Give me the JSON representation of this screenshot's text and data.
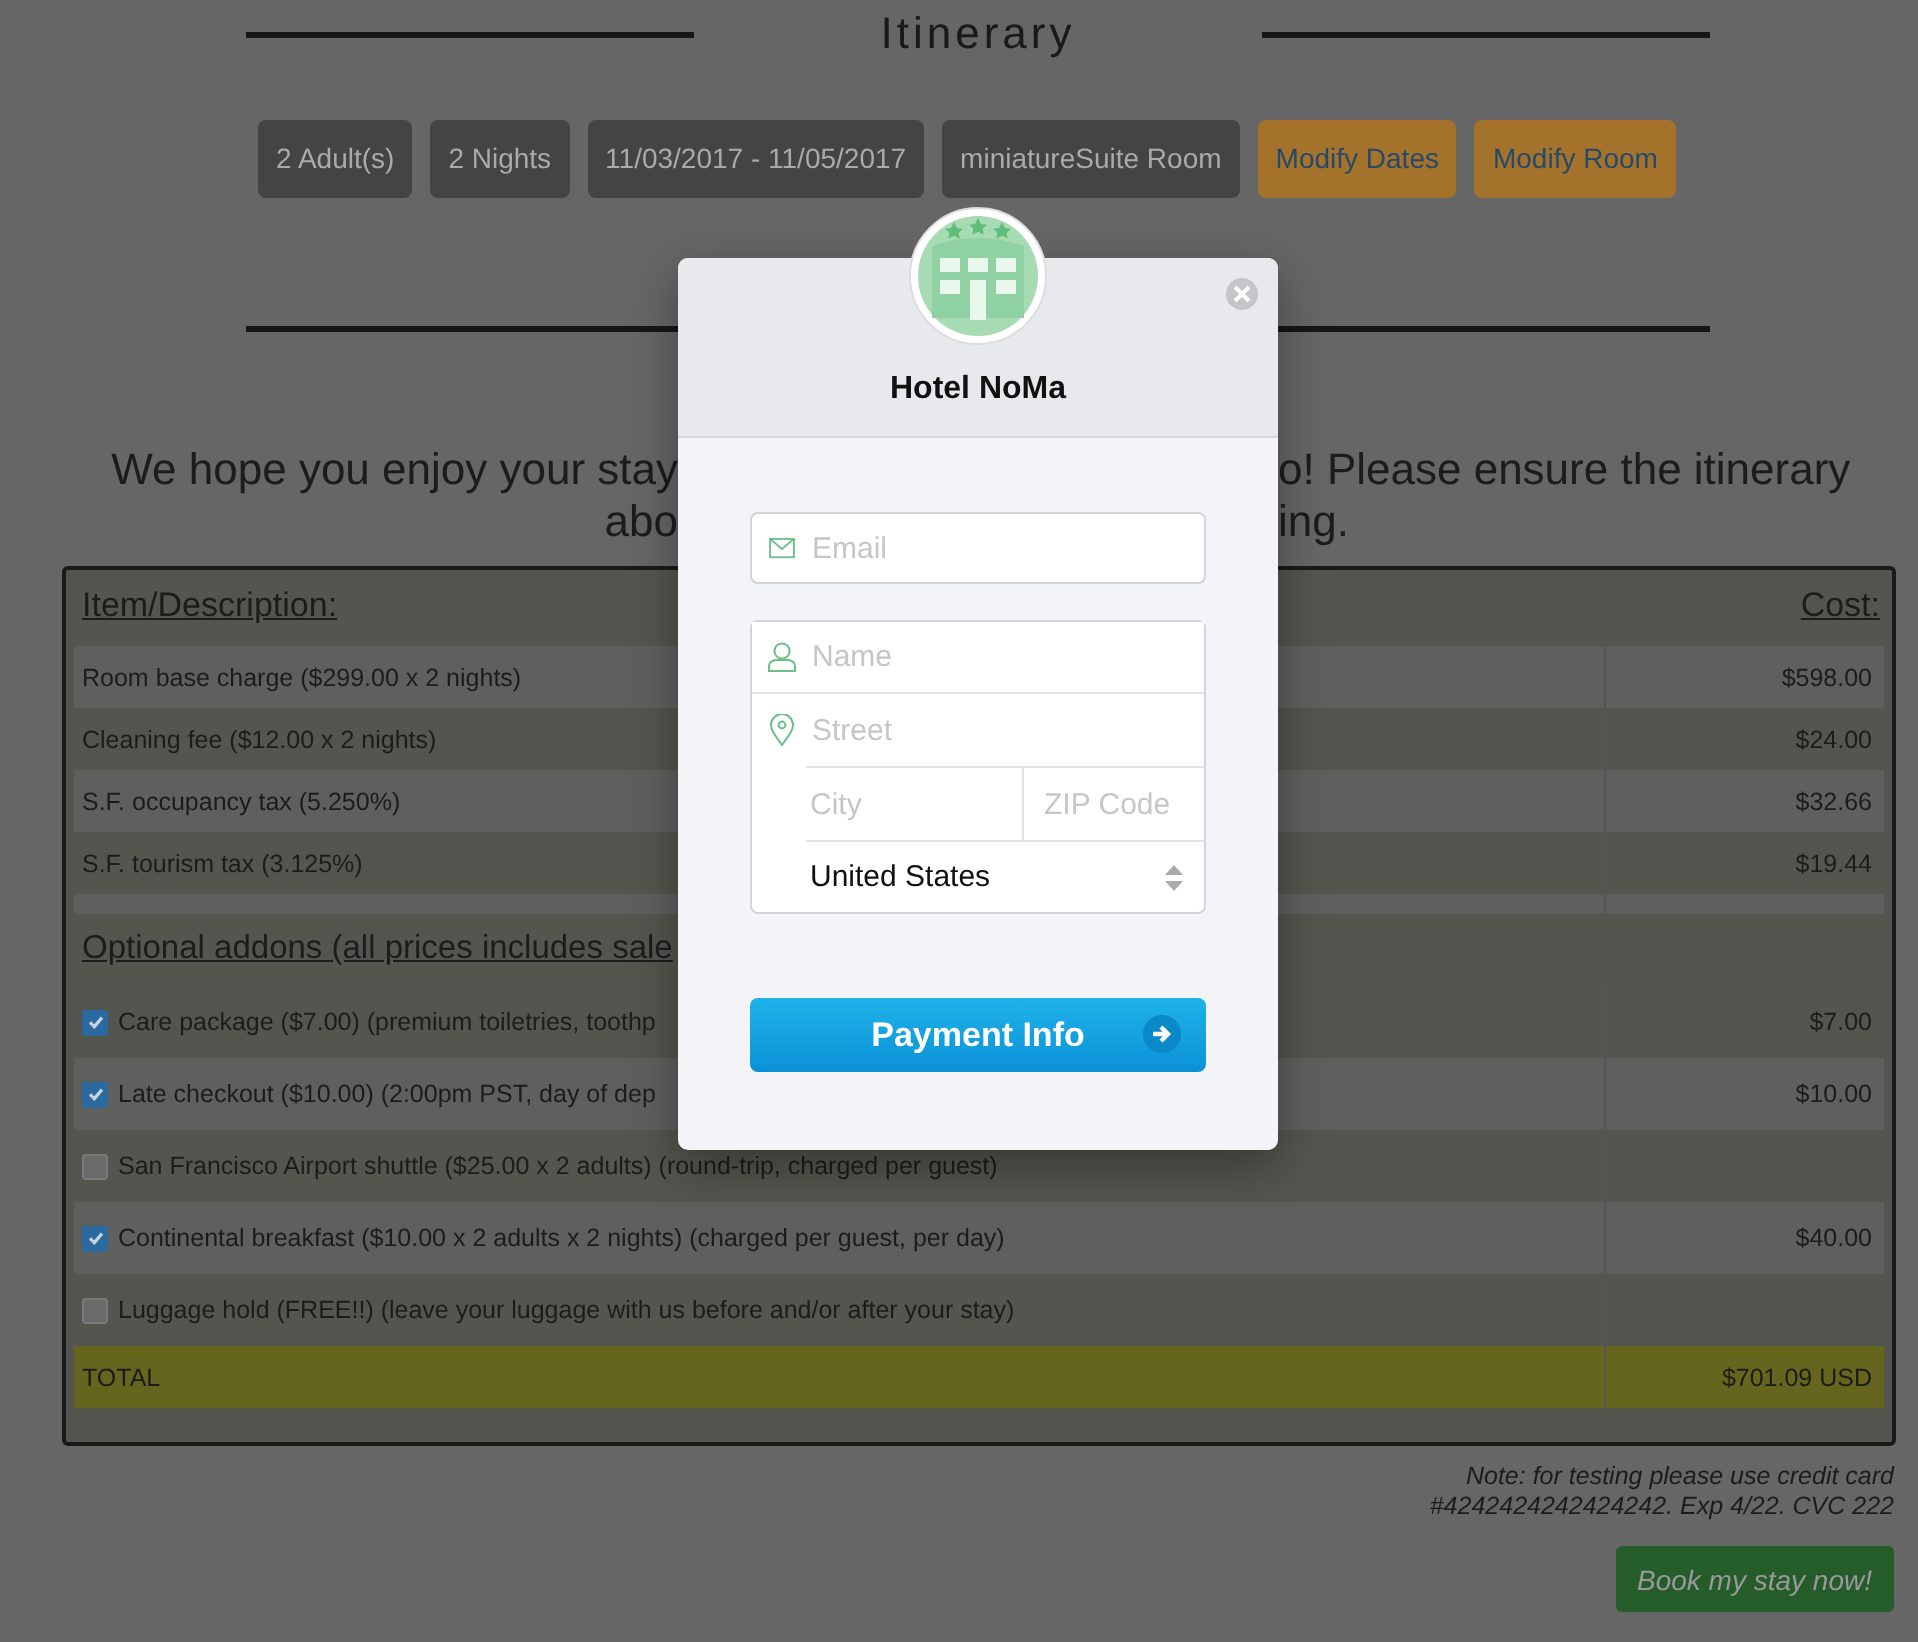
{
  "header": {
    "title": "Itinerary"
  },
  "chips": [
    {
      "label": "2 Adult(s)",
      "kind": "info"
    },
    {
      "label": "2 Nights",
      "kind": "info"
    },
    {
      "label": "11/03/2017 - 11/05/2017",
      "kind": "info"
    },
    {
      "label": "miniatureSuite Room",
      "kind": "info"
    },
    {
      "label": "Modify Dates",
      "kind": "action"
    },
    {
      "label": "Modify Room",
      "kind": "action"
    }
  ],
  "intro": [
    {
      "left": "We hope you enjoy your stay",
      "right": "o! Please ensure the itinerary"
    },
    {
      "left": "abo",
      "right": "ing."
    }
  ],
  "table": {
    "columns": [
      "Item/Description:",
      "Cost:"
    ],
    "rows": [
      {
        "kind": "item",
        "description": "Room base charge ($299.00 x 2 nights)",
        "cost": "$598.00"
      },
      {
        "kind": "item",
        "description": "Cleaning fee ($12.00 x 2 nights)",
        "cost": "$24.00"
      },
      {
        "kind": "item",
        "description": "S.F. occupancy tax (5.250%)",
        "cost": "$32.66"
      },
      {
        "kind": "item",
        "description": "S.F. tourism tax (3.125%)",
        "cost": "$19.44"
      },
      {
        "kind": "spacer"
      },
      {
        "kind": "heading",
        "description": "Optional addons (all prices includes sale"
      },
      {
        "kind": "addon",
        "checked": true,
        "description": "Care package ($7.00) (premium toiletries, toothp",
        "cost": "$7.00"
      },
      {
        "kind": "addon",
        "checked": true,
        "description": "Late checkout ($10.00) (2:00pm PST, day of dep",
        "cost": "$10.00"
      },
      {
        "kind": "addon",
        "checked": false,
        "description": "San Francisco Airport shuttle ($25.00 x 2 adults) (round-trip, charged per guest)"
      },
      {
        "kind": "addon",
        "checked": true,
        "description": "Continental breakfast ($10.00 x 2 adults x 2 nights) (charged per guest, per day)",
        "cost": "$40.00"
      },
      {
        "kind": "addon",
        "checked": false,
        "description": "Luggage hold (FREE!!) (leave your luggage with us before and/or after your stay)"
      },
      {
        "kind": "total",
        "description": "TOTAL",
        "cost": "$701.09 USD"
      }
    ]
  },
  "note": {
    "lines": [
      "Note: for testing please use credit card",
      "#4242424242424242. Exp 4/22. CVC 222"
    ]
  },
  "book_button": {
    "label": "Book my stay now!"
  },
  "modal": {
    "title": "Hotel NoMa",
    "email": {
      "placeholder": "Email"
    },
    "name": {
      "placeholder": "Name"
    },
    "street": {
      "placeholder": "Street"
    },
    "city": {
      "placeholder": "City"
    },
    "zip": {
      "placeholder": "ZIP Code"
    },
    "country": {
      "value": "United States"
    },
    "submit": {
      "label": "Payment Info"
    }
  }
}
